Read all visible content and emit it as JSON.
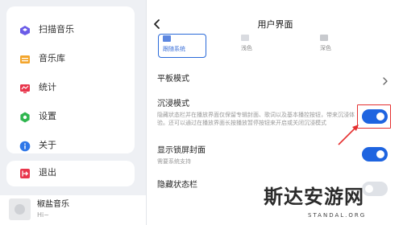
{
  "sidebar": {
    "items": [
      {
        "label": "扫描音乐",
        "icon": "scan-music-icon"
      },
      {
        "label": "音乐库",
        "icon": "music-library-icon"
      },
      {
        "label": "统计",
        "icon": "statistics-icon"
      },
      {
        "label": "设置",
        "icon": "gear-icon"
      },
      {
        "label": "关于",
        "icon": "info-icon"
      }
    ],
    "exit": {
      "label": "退出",
      "icon": "exit-icon"
    }
  },
  "player": {
    "title": "椒盐音乐",
    "artist": "Hi~"
  },
  "panel": {
    "title": "用户界面",
    "themes": [
      {
        "label": "跟随系统",
        "selected": true
      },
      {
        "label": "浅色",
        "selected": false
      },
      {
        "label": "深色",
        "selected": false
      }
    ],
    "tablet_mode": {
      "title": "平板模式"
    },
    "immersive_mode": {
      "title": "沉浸模式",
      "description": "隐藏状态栏并在播放界面仅保留专辑封面、歌词以及基本播控按钮，带来沉浸体验。还可以通过在播放界面长按播放暂停按钮来开启或关闭沉浸模式",
      "enabled": true
    },
    "lock_screen_cover": {
      "title": "显示锁屏封面",
      "description": "需要系统支持",
      "enabled": true
    },
    "hide_status_bar": {
      "title": "隐藏状态栏"
    }
  },
  "colors": {
    "accent": "#1e64e0",
    "annotation": "#e53030",
    "background": "#eef0f4"
  },
  "watermark": {
    "text": "斯达安游网",
    "sub": "STANDAL.ORG"
  }
}
